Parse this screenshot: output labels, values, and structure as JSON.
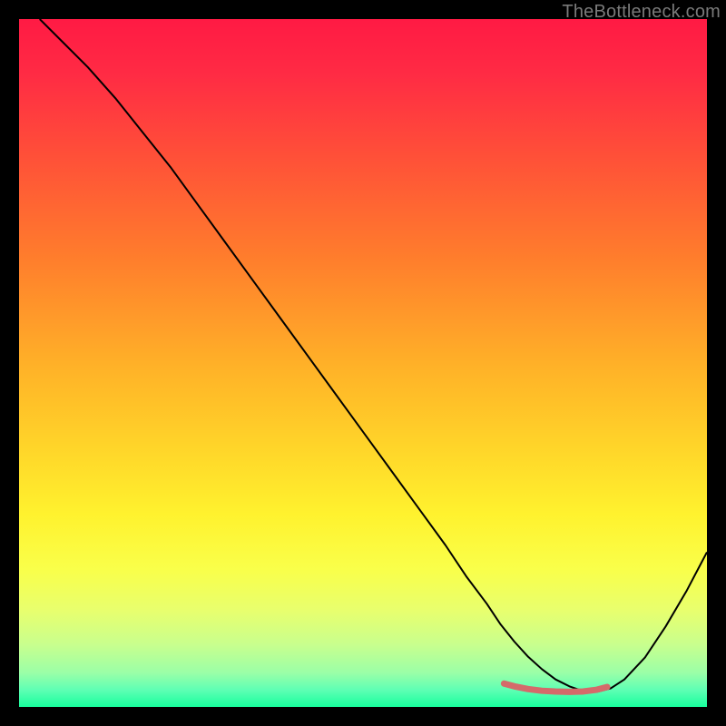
{
  "watermark": "TheBottleneck.com",
  "chart_data": {
    "type": "line",
    "title": "",
    "xlabel": "",
    "ylabel": "",
    "xlim": [
      0,
      100
    ],
    "ylim": [
      0,
      100
    ],
    "grid": false,
    "legend": "none",
    "background_gradient": {
      "stops": [
        {
          "offset": 0.0,
          "color": "#ff1a44"
        },
        {
          "offset": 0.08,
          "color": "#ff2b44"
        },
        {
          "offset": 0.2,
          "color": "#ff5038"
        },
        {
          "offset": 0.35,
          "color": "#ff7e2c"
        },
        {
          "offset": 0.5,
          "color": "#ffb028"
        },
        {
          "offset": 0.62,
          "color": "#ffd429"
        },
        {
          "offset": 0.72,
          "color": "#fff22e"
        },
        {
          "offset": 0.8,
          "color": "#f9ff4a"
        },
        {
          "offset": 0.86,
          "color": "#e8ff6e"
        },
        {
          "offset": 0.91,
          "color": "#c8ff8e"
        },
        {
          "offset": 0.95,
          "color": "#9bffa7"
        },
        {
          "offset": 0.975,
          "color": "#5fffb4"
        },
        {
          "offset": 1.0,
          "color": "#17ff9d"
        }
      ]
    },
    "series": [
      {
        "name": "bottleneck-curve",
        "color": "#000000",
        "width": 2,
        "x": [
          3,
          6,
          10,
          14,
          18,
          22,
          26,
          30,
          34,
          38,
          42,
          46,
          50,
          54,
          58,
          62,
          65,
          68,
          70,
          72,
          74,
          76,
          78,
          80,
          82,
          84,
          86,
          88,
          91,
          94,
          97,
          100
        ],
        "y": [
          100,
          97,
          93,
          88.5,
          83.5,
          78.5,
          73,
          67.5,
          62,
          56.5,
          51,
          45.5,
          40,
          34.5,
          29,
          23.5,
          19,
          15,
          12,
          9.5,
          7.3,
          5.5,
          4.0,
          3.0,
          2.3,
          2.2,
          2.7,
          4.0,
          7.2,
          11.7,
          16.8,
          22.5
        ]
      },
      {
        "name": "sweet-spot-highlight",
        "color": "#d46a6a",
        "width": 7,
        "linecap": "round",
        "x": [
          70.5,
          72,
          74,
          76,
          78,
          80,
          82,
          84,
          85.5
        ],
        "y": [
          3.4,
          3.0,
          2.6,
          2.35,
          2.25,
          2.2,
          2.25,
          2.5,
          2.9
        ]
      }
    ]
  }
}
